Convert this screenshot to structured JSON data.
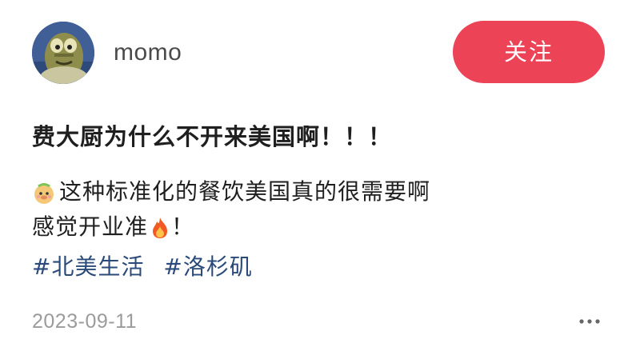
{
  "post": {
    "author": {
      "username": "momo",
      "follow_label": "关注"
    },
    "title": "费大厨为什么不开来美国啊！！！",
    "body": {
      "line1": "这种标准化的餐饮美国真的很需要啊",
      "line2_prefix": "感觉开业准",
      "line2_suffix": "！"
    },
    "tags": [
      "#北美生活",
      "#洛杉矶"
    ],
    "date": "2023-09-11",
    "icons": {
      "avatar": "cartoon-fish-avatar",
      "line1_emoji": "cute-face-emoji",
      "line2_emoji": "fire-emoji",
      "more": "more-dots-icon"
    },
    "colors": {
      "follow_button": "#ec4357",
      "tag": "#2a4a7a",
      "date": "#9b9b9b"
    }
  }
}
